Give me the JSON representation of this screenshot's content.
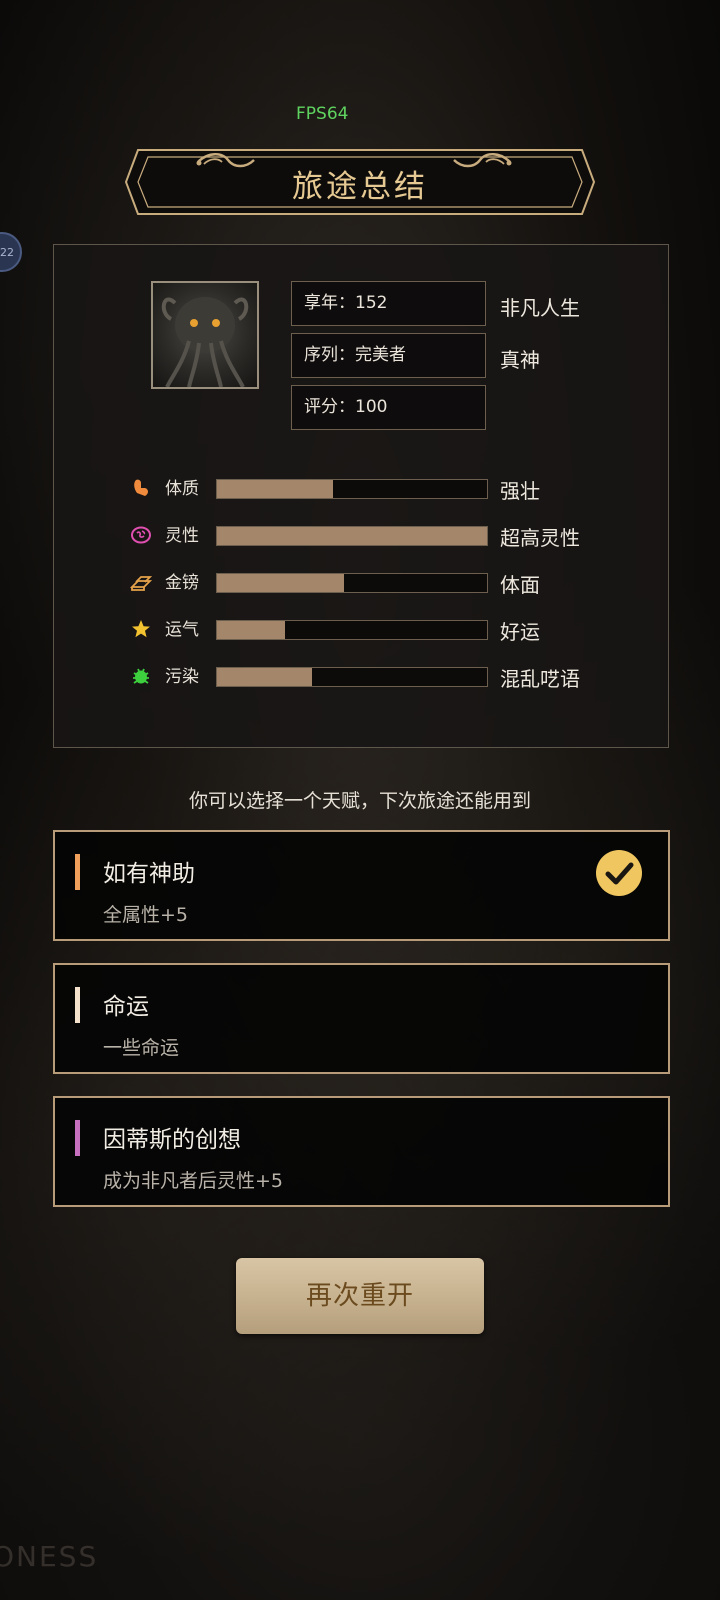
{
  "fps": "FPS64",
  "side_badge": "22",
  "title": "旅途总结",
  "info": {
    "age": "享年：152",
    "age_tag": "非凡人生",
    "sequence": "序列：完美者",
    "sequence_tag": "真神",
    "score": "评分：100"
  },
  "stats": [
    {
      "label": "体质",
      "desc": "强壮",
      "fill": 0.43,
      "icon": "muscle-icon",
      "color": "#f08a3c"
    },
    {
      "label": "灵性",
      "desc": "超高灵性",
      "fill": 1.0,
      "icon": "brain-icon",
      "color": "#e04fb0"
    },
    {
      "label": "金镑",
      "desc": "体面",
      "fill": 0.47,
      "icon": "gold-bars-icon",
      "color": "#e6a24a"
    },
    {
      "label": "运气",
      "desc": "好运",
      "fill": 0.25,
      "icon": "star-icon",
      "color": "#f2c230"
    },
    {
      "label": "污染",
      "desc": "混乱呓语",
      "fill": 0.35,
      "icon": "bug-icon",
      "color": "#3ecf3e"
    }
  ],
  "hint": "你可以选择一个天赋，下次旅途还能用到",
  "talents": [
    {
      "title": "如有神助",
      "desc": "全属性+5",
      "accent": "#f0a05a",
      "selected": true
    },
    {
      "title": "命运",
      "desc": "一些命运",
      "accent": "#f4e2cc",
      "selected": false
    },
    {
      "title": "因蒂斯的创想",
      "desc": "成为非凡者后灵性+5",
      "accent": "#c870c0",
      "selected": false
    }
  ],
  "restart_label": "再次重开",
  "watermark": "ONESS"
}
